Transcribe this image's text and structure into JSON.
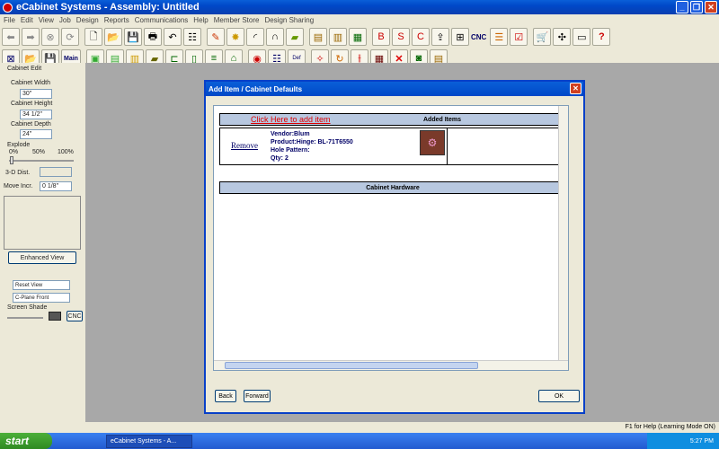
{
  "app": {
    "title": "eCabinet Systems - Assembly: Untitled"
  },
  "menu": [
    "File",
    "Edit",
    "View",
    "Job",
    "Design",
    "Reports",
    "Communications",
    "Help",
    "Member Store",
    "Design Sharing"
  ],
  "toolbar": {
    "cnc_label": "CNC",
    "main_label": "Main"
  },
  "left": {
    "section": "Cabinet Edit",
    "width_label": "Cabinet Width",
    "width_value": "30\"",
    "height_label": "Cabinet Height",
    "height_value": "34 1/2\"",
    "depth_label": "Cabinet Depth",
    "depth_value": "24\"",
    "explode_label": "Explode",
    "explode_ticks": [
      "0%",
      "50%",
      "100%"
    ],
    "dist_label": "3-D Dist.",
    "move_label": "Move Incr.",
    "move_value": "0 1/8\"",
    "enhanced_btn": "Enhanced View",
    "reset_view": "Reset View",
    "cplane": "C-Plane Front",
    "screen_shade": "Screen Shade",
    "cnc_btn": "CNC"
  },
  "dialog": {
    "title": "Add Item / Cabinet Defaults",
    "add_link": "Click Here to add item",
    "added_header": "Added Items",
    "remove_link": "Remove",
    "vendor": "Vendor:Blum",
    "product": "Product:Hinge: BL-71T6550",
    "hole": "Hole Pattern:",
    "qty": "Qty: 2",
    "hardware_header": "Cabinet Hardware",
    "back_btn": "Back",
    "forward_btn": "Forward",
    "ok_btn": "OK"
  },
  "status": {
    "help": "F1 for Help (Learning Mode ON)"
  },
  "taskbar": {
    "start": "start",
    "task": "eCabinet Systems - A...",
    "time": "5:27 PM"
  }
}
